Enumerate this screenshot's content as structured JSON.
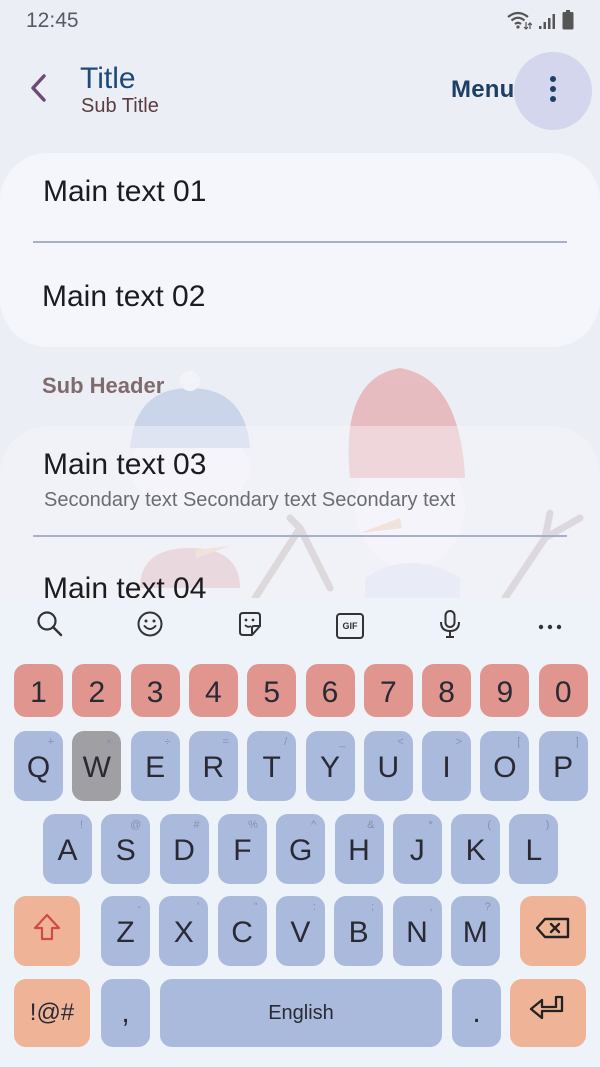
{
  "status_bar": {
    "time": "12:45",
    "icons": [
      "wifi-icon",
      "signal-icon",
      "battery-icon"
    ]
  },
  "app_bar": {
    "back_icon": "chevron-left-icon",
    "title": "Title",
    "subtitle": "Sub Title",
    "menu_label": "Menu",
    "more_icon": "more-vert-icon"
  },
  "list": {
    "group1": [
      {
        "main": "Main text 01"
      },
      {
        "main": "Main text 02"
      }
    ],
    "sub_header": "Sub Header",
    "group2": [
      {
        "main": "Main text 03",
        "secondary": "Secondary text Secondary text Secondary text"
      },
      {
        "main": "Main text 04"
      }
    ]
  },
  "keyboard": {
    "toolbar": [
      "search-icon",
      "emoji-icon",
      "sticker-icon",
      "gif-icon",
      "mic-icon",
      "more-horiz-icon"
    ],
    "gif_label": "GIF",
    "number_row": [
      "1",
      "2",
      "3",
      "4",
      "5",
      "6",
      "7",
      "8",
      "9",
      "0"
    ],
    "row1": [
      {
        "key": "Q",
        "hint": "+"
      },
      {
        "key": "W",
        "hint": "×"
      },
      {
        "key": "E",
        "hint": "÷"
      },
      {
        "key": "R",
        "hint": "="
      },
      {
        "key": "T",
        "hint": "/"
      },
      {
        "key": "Y",
        "hint": "_"
      },
      {
        "key": "U",
        "hint": "<"
      },
      {
        "key": "I",
        "hint": ">"
      },
      {
        "key": "O",
        "hint": "["
      },
      {
        "key": "P",
        "hint": "]"
      }
    ],
    "row2": [
      {
        "key": "A",
        "hint": "!"
      },
      {
        "key": "S",
        "hint": "@"
      },
      {
        "key": "D",
        "hint": "#"
      },
      {
        "key": "F",
        "hint": "%"
      },
      {
        "key": "G",
        "hint": "^"
      },
      {
        "key": "H",
        "hint": "&"
      },
      {
        "key": "J",
        "hint": "*"
      },
      {
        "key": "K",
        "hint": "("
      },
      {
        "key": "L",
        "hint": ")"
      }
    ],
    "row3": [
      {
        "key": "Z",
        "hint": "-"
      },
      {
        "key": "X",
        "hint": "'"
      },
      {
        "key": "C",
        "hint": "\""
      },
      {
        "key": "V",
        "hint": ":"
      },
      {
        "key": "B",
        "hint": ";"
      },
      {
        "key": "N",
        "hint": ","
      },
      {
        "key": "M",
        "hint": "?"
      }
    ],
    "pressed_key": "W",
    "shift_icon": "shift-icon",
    "backspace_icon": "backspace-icon",
    "symbols_label": "!@#",
    "comma_label": ",",
    "space_label": "English",
    "period_label": ".",
    "enter_icon": "enter-icon"
  },
  "colors": {
    "number_key": "#e0968f",
    "letter_key": "#a9badc",
    "function_key": "#efb497",
    "pressed_key": "#a0a0a4",
    "title": "#1d4a7a"
  }
}
